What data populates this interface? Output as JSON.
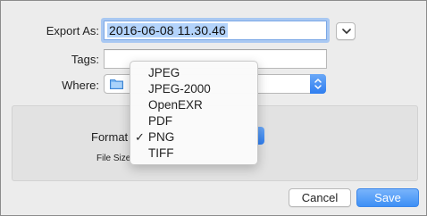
{
  "dialog": {
    "export_as_label": "Export As:",
    "export_as_value": "2016-06-08 11.30.46",
    "tags_label": "Tags:",
    "tags_value": "",
    "where_label": "Where:"
  },
  "options": {
    "format_label": "Format",
    "file_size_label": "File Size",
    "selected_format": "PNG"
  },
  "format_menu": {
    "items": [
      {
        "label": "JPEG",
        "checked": false
      },
      {
        "label": "JPEG-2000",
        "checked": false
      },
      {
        "label": "OpenEXR",
        "checked": false
      },
      {
        "label": "PDF",
        "checked": false
      },
      {
        "label": "PNG",
        "checked": true
      },
      {
        "label": "TIFF",
        "checked": false
      }
    ],
    "check_glyph": "✓"
  },
  "buttons": {
    "cancel_label": "Cancel",
    "save_label": "Save"
  },
  "icons": {
    "disclosure": "chevron-down-icon",
    "where_folder": "folder-icon",
    "popup_arrows": "up-down-arrows-icon"
  },
  "colors": {
    "accent": "#3d8ff5",
    "selection": "#b3d3fb",
    "focus_ring": "#a9c8f2",
    "sheet_background": "#ececec"
  }
}
